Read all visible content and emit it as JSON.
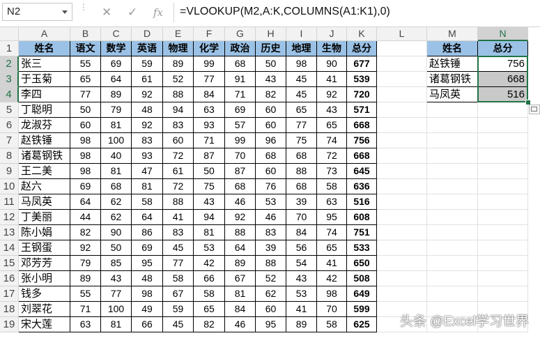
{
  "formula_bar": {
    "name_box": "N2",
    "cancel_glyph": "✕",
    "enter_glyph": "✓",
    "fx_glyph": "fx",
    "formula": "=VLOOKUP(M2,A:K,COLUMNS(A1:K1),0)"
  },
  "sheet": {
    "columns": [
      "A",
      "B",
      "C",
      "D",
      "E",
      "F",
      "G",
      "H",
      "I",
      "J",
      "K",
      "L",
      "M",
      "N"
    ],
    "rows": [
      "1",
      "2",
      "3",
      "4",
      "5",
      "6",
      "7",
      "8",
      "9",
      "10",
      "11",
      "12",
      "13",
      "14",
      "15",
      "16",
      "17",
      "18",
      "19"
    ],
    "selected_column": "N",
    "selected_rows": [
      "2",
      "3",
      "4"
    ]
  },
  "score_table": {
    "headers": [
      "姓名",
      "语文",
      "数学",
      "英语",
      "物理",
      "化学",
      "政治",
      "历史",
      "地理",
      "生物",
      "总分"
    ],
    "rows": [
      [
        "张三",
        "55",
        "69",
        "59",
        "89",
        "99",
        "68",
        "50",
        "98",
        "90",
        "677"
      ],
      [
        "于玉菊",
        "65",
        "64",
        "61",
        "52",
        "77",
        "91",
        "43",
        "45",
        "41",
        "539"
      ],
      [
        "李四",
        "77",
        "89",
        "92",
        "88",
        "84",
        "71",
        "82",
        "45",
        "92",
        "720"
      ],
      [
        "丁聪明",
        "50",
        "79",
        "48",
        "94",
        "63",
        "69",
        "60",
        "65",
        "43",
        "571"
      ],
      [
        "龙淑芬",
        "60",
        "81",
        "92",
        "83",
        "93",
        "57",
        "60",
        "77",
        "65",
        "668"
      ],
      [
        "赵铁锤",
        "98",
        "100",
        "83",
        "60",
        "71",
        "99",
        "96",
        "75",
        "74",
        "756"
      ],
      [
        "诸葛钢铁",
        "98",
        "40",
        "93",
        "72",
        "87",
        "70",
        "68",
        "68",
        "72",
        "668"
      ],
      [
        "王二美",
        "98",
        "81",
        "47",
        "61",
        "50",
        "87",
        "60",
        "88",
        "73",
        "645"
      ],
      [
        "赵六",
        "69",
        "68",
        "81",
        "72",
        "75",
        "68",
        "76",
        "68",
        "58",
        "636"
      ],
      [
        "马凤英",
        "64",
        "62",
        "58",
        "88",
        "43",
        "46",
        "53",
        "39",
        "63",
        "516"
      ],
      [
        "丁美丽",
        "44",
        "62",
        "64",
        "41",
        "94",
        "92",
        "46",
        "70",
        "95",
        "608"
      ],
      [
        "陈小娟",
        "82",
        "90",
        "86",
        "83",
        "81",
        "88",
        "83",
        "84",
        "74",
        "751"
      ],
      [
        "王钢蛋",
        "92",
        "50",
        "69",
        "45",
        "53",
        "64",
        "39",
        "56",
        "65",
        "533"
      ],
      [
        "邓芳芳",
        "79",
        "85",
        "95",
        "77",
        "42",
        "89",
        "88",
        "54",
        "41",
        "650"
      ],
      [
        "张小明",
        "89",
        "43",
        "48",
        "58",
        "66",
        "67",
        "52",
        "43",
        "42",
        "508"
      ],
      [
        "钱多",
        "55",
        "77",
        "98",
        "67",
        "58",
        "81",
        "62",
        "53",
        "98",
        "649"
      ],
      [
        "刘翠花",
        "71",
        "100",
        "49",
        "59",
        "65",
        "84",
        "60",
        "41",
        "70",
        "599"
      ],
      [
        "宋大莲",
        "63",
        "81",
        "66",
        "45",
        "82",
        "46",
        "95",
        "89",
        "58",
        "625"
      ]
    ]
  },
  "lookup_table": {
    "headers": [
      "姓名",
      "总分"
    ],
    "rows": [
      [
        "赵铁锤",
        "756"
      ],
      [
        "诸葛钢铁",
        "668"
      ],
      [
        "马凤英",
        "516"
      ]
    ]
  },
  "colors": {
    "header_fill": "#9bc2e6",
    "selection": "#217346",
    "highlight_fill": "#c9c9c9"
  },
  "watermark": "头条 @Excel学习世界"
}
